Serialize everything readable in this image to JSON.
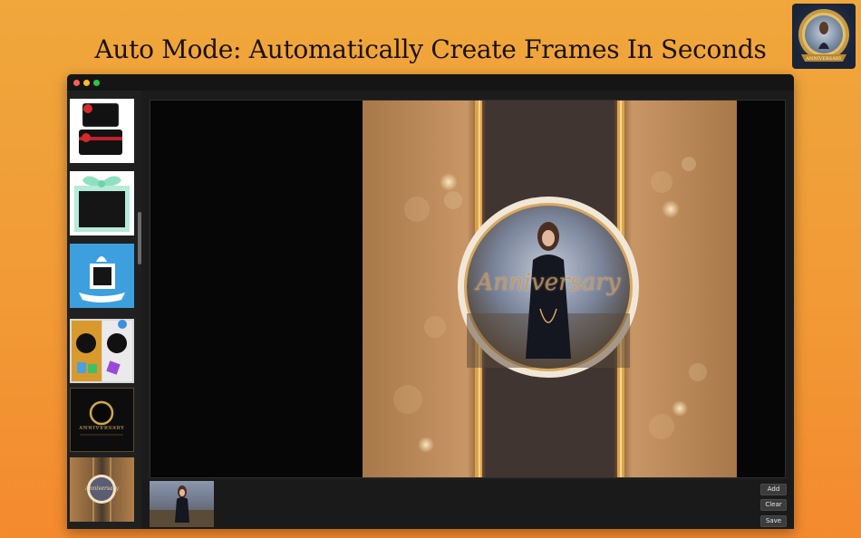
{
  "headline": "Auto Mode: Automatically Create Frames In Seconds",
  "window": {
    "traffic_lights": {
      "close": "#fe5f57",
      "minimize": "#febc2e",
      "zoom": "#28c840"
    }
  },
  "sidebar": {
    "thumbnails": [
      {
        "name": "ribbon-cards"
      },
      {
        "name": "green-gift-frame"
      },
      {
        "name": "blue-gift-frame"
      },
      {
        "name": "collage-gift-frame"
      },
      {
        "name": "anniversary-black-frame",
        "caption": "ANNIVERSARY"
      },
      {
        "name": "anniversary-gold-frame",
        "caption": "Anniversary"
      }
    ]
  },
  "preview": {
    "overlay_text": "Anniversary"
  },
  "toolbar": {
    "add_label": "Add",
    "clear_label": "Clear",
    "save_label": "Save"
  },
  "app_icon": {
    "caption": "ANNIVERSARY"
  },
  "colors": {
    "accent_gold": "#d6a45c",
    "background": "#f0a03a"
  }
}
